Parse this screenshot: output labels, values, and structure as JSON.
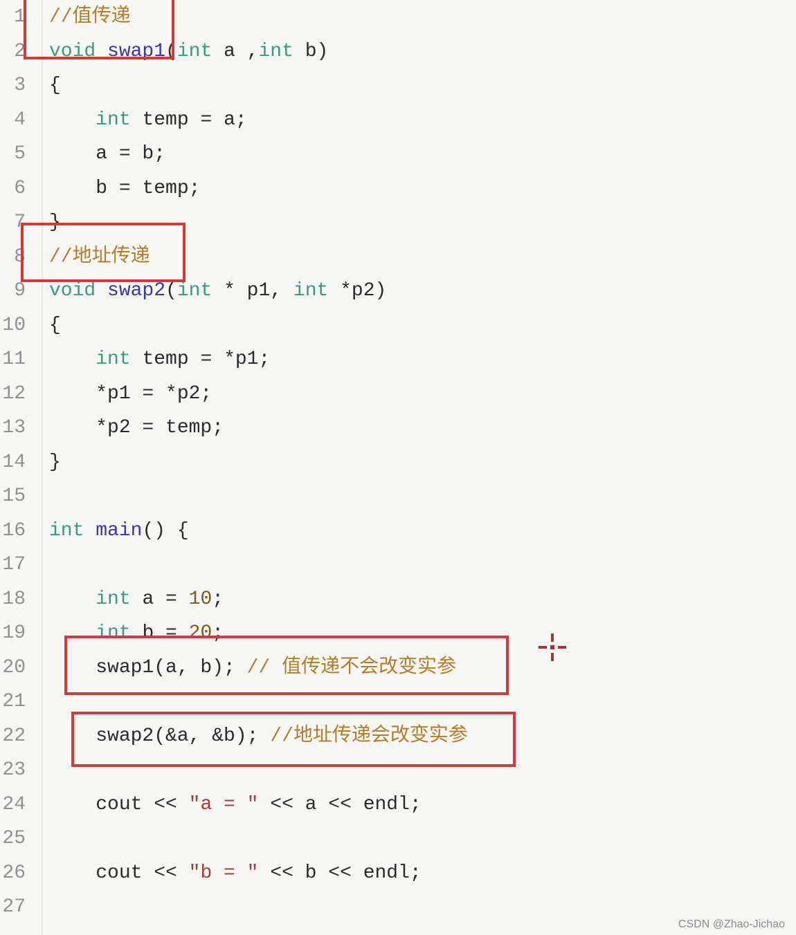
{
  "colors": {
    "keyword": "#3b9a7e",
    "function": "#3a36a8",
    "comment": "#b07d2c",
    "string": "#a83a3a",
    "text": "#2a2a2a",
    "highlight_box": "#d23a3a"
  },
  "code": {
    "lines": [
      {
        "n": "1",
        "tokens": [
          {
            "t": "//值传递",
            "k": "cm"
          }
        ]
      },
      {
        "n": "2",
        "tokens": [
          {
            "t": "void ",
            "k": "kw"
          },
          {
            "t": "swap1",
            "k": "fn"
          },
          {
            "t": "(",
            "k": ""
          },
          {
            "t": "int",
            "k": "kw"
          },
          {
            "t": " a ,",
            "k": ""
          },
          {
            "t": "int",
            "k": "kw"
          },
          {
            "t": " b)",
            "k": ""
          }
        ]
      },
      {
        "n": "3",
        "tokens": [
          {
            "t": "{",
            "k": ""
          }
        ]
      },
      {
        "n": "4",
        "tokens": [
          {
            "t": "    ",
            "k": ""
          },
          {
            "t": "int",
            "k": "kw"
          },
          {
            "t": " temp = a;",
            "k": ""
          }
        ]
      },
      {
        "n": "5",
        "tokens": [
          {
            "t": "    a = b;",
            "k": ""
          }
        ]
      },
      {
        "n": "6",
        "tokens": [
          {
            "t": "    b = temp;",
            "k": ""
          }
        ]
      },
      {
        "n": "7",
        "tokens": [
          {
            "t": "}",
            "k": ""
          }
        ]
      },
      {
        "n": "8",
        "tokens": [
          {
            "t": "//地址传递",
            "k": "cm"
          }
        ]
      },
      {
        "n": "9",
        "tokens": [
          {
            "t": "void ",
            "k": "kw"
          },
          {
            "t": "swap2",
            "k": "fn"
          },
          {
            "t": "(",
            "k": ""
          },
          {
            "t": "int",
            "k": "kw"
          },
          {
            "t": " * p1, ",
            "k": ""
          },
          {
            "t": "int",
            "k": "kw"
          },
          {
            "t": " *p2)",
            "k": ""
          }
        ]
      },
      {
        "n": "10",
        "tokens": [
          {
            "t": "{",
            "k": ""
          }
        ]
      },
      {
        "n": "11",
        "tokens": [
          {
            "t": "    ",
            "k": ""
          },
          {
            "t": "int",
            "k": "kw"
          },
          {
            "t": " temp = *p1;",
            "k": ""
          }
        ]
      },
      {
        "n": "12",
        "tokens": [
          {
            "t": "    *p1 = *p2;",
            "k": ""
          }
        ]
      },
      {
        "n": "13",
        "tokens": [
          {
            "t": "    *p2 = temp;",
            "k": ""
          }
        ]
      },
      {
        "n": "14",
        "tokens": [
          {
            "t": "}",
            "k": ""
          }
        ]
      },
      {
        "n": "15",
        "tokens": []
      },
      {
        "n": "16",
        "tokens": [
          {
            "t": "int ",
            "k": "kw"
          },
          {
            "t": "main",
            "k": "fn"
          },
          {
            "t": "() {",
            "k": ""
          }
        ]
      },
      {
        "n": "17",
        "tokens": []
      },
      {
        "n": "18",
        "tokens": [
          {
            "t": "    ",
            "k": ""
          },
          {
            "t": "int",
            "k": "kw"
          },
          {
            "t": " a = ",
            "k": ""
          },
          {
            "t": "10",
            "k": "nm"
          },
          {
            "t": ";",
            "k": ""
          }
        ]
      },
      {
        "n": "19",
        "tokens": [
          {
            "t": "    ",
            "k": ""
          },
          {
            "t": "int",
            "k": "kw"
          },
          {
            "t": " b = ",
            "k": ""
          },
          {
            "t": "20",
            "k": "nm"
          },
          {
            "t": ";",
            "k": ""
          }
        ]
      },
      {
        "n": "20",
        "tokens": [
          {
            "t": "    swap1(a, b); ",
            "k": ""
          },
          {
            "t": "// 值传递不会改变实参",
            "k": "cm"
          }
        ]
      },
      {
        "n": "21",
        "tokens": []
      },
      {
        "n": "22",
        "tokens": [
          {
            "t": "    swap2(&a, &b); ",
            "k": ""
          },
          {
            "t": "//地址传递会改变实参",
            "k": "cm"
          }
        ]
      },
      {
        "n": "23",
        "tokens": []
      },
      {
        "n": "24",
        "tokens": [
          {
            "t": "    cout << ",
            "k": ""
          },
          {
            "t": "\"a = \"",
            "k": "st"
          },
          {
            "t": " << a << endl;",
            "k": ""
          }
        ]
      },
      {
        "n": "25",
        "tokens": []
      },
      {
        "n": "26",
        "tokens": [
          {
            "t": "    cout << ",
            "k": ""
          },
          {
            "t": "\"b = \"",
            "k": "st"
          },
          {
            "t": " << b << endl;",
            "k": ""
          }
        ]
      },
      {
        "n": "27",
        "tokens": []
      }
    ]
  },
  "cursor_icon": "crosshair-move-icon",
  "watermark": "CSDN @Zhao-Jichao"
}
